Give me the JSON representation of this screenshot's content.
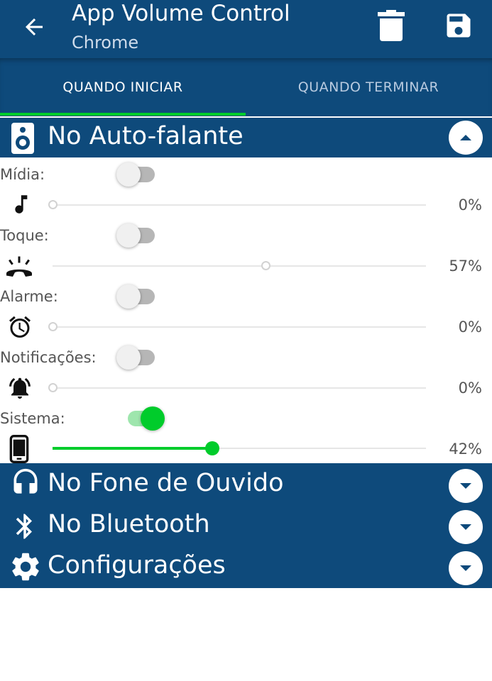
{
  "app": {
    "title": "App Volume Control",
    "subtitle": "Chrome"
  },
  "icons": {
    "back": "arrow-back-icon",
    "delete": "trash-icon",
    "save": "floppy-save-icon"
  },
  "tabs": [
    {
      "label": "QUANDO INICIAR",
      "active": true
    },
    {
      "label": "QUANDO TERMINAR",
      "active": false
    }
  ],
  "colors": {
    "primary": "#0e4a7b",
    "accent": "#00cc2b"
  },
  "speaker_section": {
    "label": "No Auto-falante",
    "expanded": true,
    "rows": [
      {
        "label": "Mídia:",
        "enabled": false,
        "icon": "music-note-icon",
        "value": "0%",
        "level": 0
      },
      {
        "label": "Toque:",
        "enabled": false,
        "icon": "ringing-phone-icon",
        "value": "57%",
        "level": 57
      },
      {
        "label": "Alarme:",
        "enabled": false,
        "icon": "alarm-clock-icon",
        "value": "0%",
        "level": 0
      },
      {
        "label": "Notificações:",
        "enabled": false,
        "icon": "bell-ring-icon",
        "value": "0%",
        "level": 0
      },
      {
        "label": "Sistema:",
        "enabled": true,
        "icon": "phone-device-icon",
        "value": "42%",
        "level": 42
      }
    ]
  },
  "collapsed_sections": [
    {
      "label": "No Fone de Ouvido",
      "icon": "headphones-icon",
      "expanded": false
    },
    {
      "label": "No Bluetooth",
      "icon": "bluetooth-icon",
      "expanded": false
    },
    {
      "label": "Configurações",
      "icon": "gear-icon",
      "expanded": false
    }
  ]
}
